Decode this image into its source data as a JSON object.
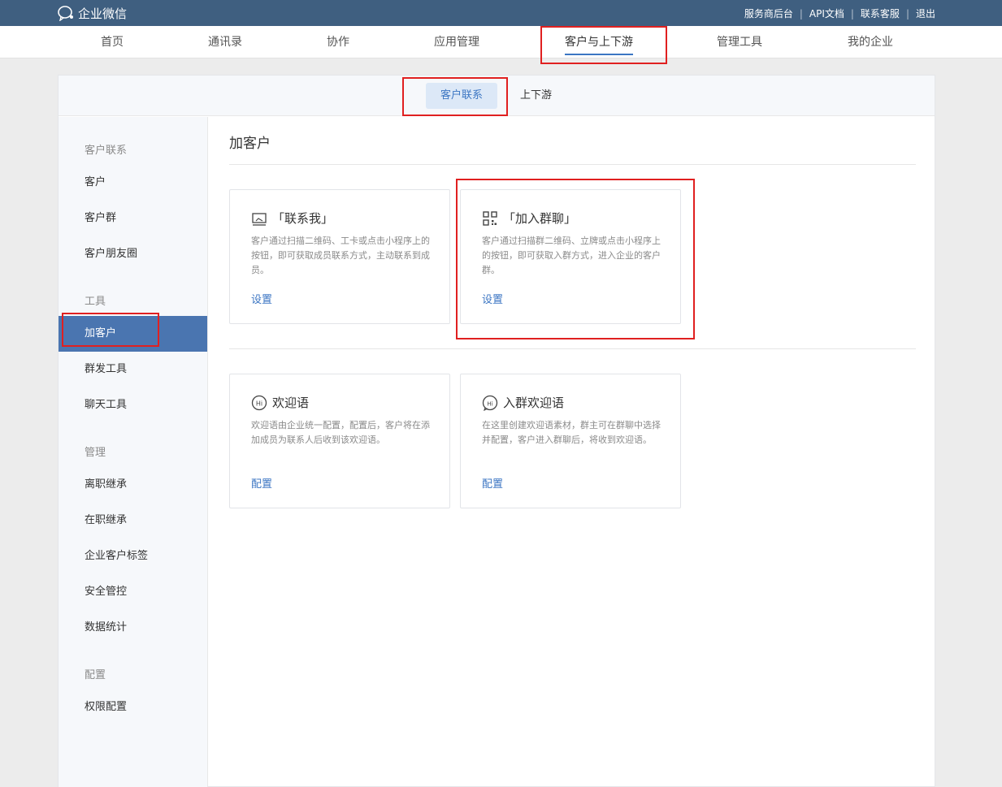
{
  "app": {
    "title": "企业微信"
  },
  "top_links": [
    "服务商后台",
    "API文档",
    "联系客服",
    "退出"
  ],
  "nav": [
    {
      "label": "首页"
    },
    {
      "label": "通讯录"
    },
    {
      "label": "协作"
    },
    {
      "label": "应用管理"
    },
    {
      "label": "客户与上下游",
      "active": true
    },
    {
      "label": "管理工具"
    },
    {
      "label": "我的企业"
    }
  ],
  "subtabs": [
    {
      "label": "客户联系",
      "active": true
    },
    {
      "label": "上下游"
    }
  ],
  "sidebar": {
    "groups": [
      {
        "label": "客户联系",
        "items": [
          "客户",
          "客户群",
          "客户朋友圈"
        ]
      },
      {
        "label": "工具",
        "items": [
          "加客户",
          "群发工具",
          "聊天工具"
        ]
      },
      {
        "label": "管理",
        "items": [
          "离职继承",
          "在职继承",
          "企业客户标签",
          "安全管控",
          "数据统计"
        ]
      },
      {
        "label": "配置",
        "items": [
          "权限配置"
        ]
      }
    ],
    "active_item": "加客户"
  },
  "main": {
    "title": "加客户",
    "cards": [
      {
        "title": "「联系我」",
        "icon": "contact-me-icon",
        "desc": "客户通过扫描二维码、工卡或点击小程序上的按钮，即可获取成员联系方式，主动联系到成员。",
        "action": "设置"
      },
      {
        "title": "「加入群聊」",
        "icon": "qrcode-icon",
        "desc": "客户通过扫描群二维码、立牌或点击小程序上的按钮，即可获取入群方式，进入企业的客户群。",
        "action": "设置"
      },
      {
        "title": "欢迎语",
        "icon": "hi-icon",
        "desc": "欢迎语由企业统一配置，配置后，客户将在添加成员为联系人后收到该欢迎语。",
        "action": "配置"
      },
      {
        "title": "入群欢迎语",
        "icon": "group-hi-icon",
        "desc": "在这里创建欢迎语素材，群主可在群聊中选择并配置，客户进入群聊后，将收到欢迎语。",
        "action": "配置"
      }
    ]
  },
  "colors": {
    "topbar": "#3f5f80",
    "accent": "#3c76c3",
    "sidebar_active": "#4a75b0",
    "highlight": "#e02020"
  }
}
